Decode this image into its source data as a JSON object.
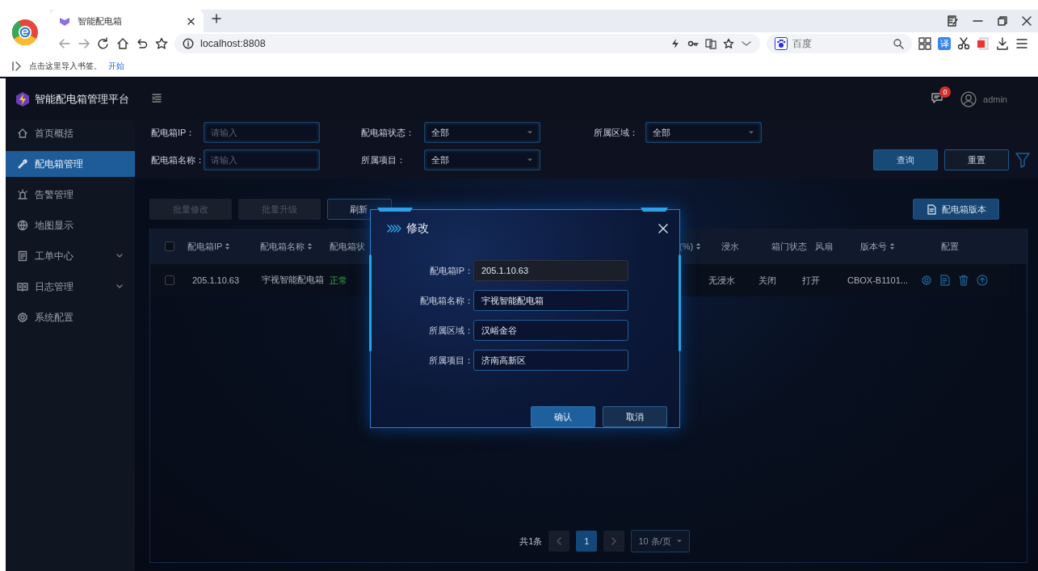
{
  "browser": {
    "tab_title": "智能配电箱",
    "address": "localhost:8808",
    "search_engine": "百度",
    "translate_badge": "译",
    "bookmark_hint": "点击这里导入书签。",
    "bookmark_link": "开始"
  },
  "app": {
    "title": "智能配电箱管理平台",
    "notification_count": "0",
    "user": "admin"
  },
  "sidebar": {
    "items": [
      {
        "label": "首页概括",
        "selected": false,
        "has_submenu": false
      },
      {
        "label": "配电箱管理",
        "selected": true,
        "has_submenu": false
      },
      {
        "label": "告警管理",
        "selected": false,
        "has_submenu": false
      },
      {
        "label": "地图显示",
        "selected": false,
        "has_submenu": false
      },
      {
        "label": "工单中心",
        "selected": false,
        "has_submenu": true
      },
      {
        "label": "日志管理",
        "selected": false,
        "has_submenu": true
      },
      {
        "label": "系统配置",
        "selected": false,
        "has_submenu": false
      }
    ]
  },
  "filters": [
    {
      "label": "配电箱IP：",
      "kind": "text",
      "placeholder": "请输入"
    },
    {
      "label": "配电箱状态：",
      "kind": "select",
      "value": "全部"
    },
    {
      "label": "所属区域：",
      "kind": "select",
      "value": "全部"
    },
    {
      "label": "配电箱名称：",
      "kind": "text",
      "placeholder": "请输入"
    },
    {
      "label": "所属项目：",
      "kind": "select",
      "value": "全部"
    }
  ],
  "filter_buttons": [
    {
      "label": "查询",
      "primary": true
    },
    {
      "label": "重置",
      "primary": false
    }
  ],
  "actions": [
    {
      "label": "批量修改",
      "disabled": true
    },
    {
      "label": "批量升级",
      "disabled": true
    },
    {
      "label": "刷新",
      "disabled": false
    }
  ],
  "version_button": "配电箱版本",
  "table": {
    "select_all_checked": false,
    "columns": [
      {
        "label": "配电箱IP",
        "sortable": true
      },
      {
        "label": "配电箱名称",
        "sortable": true
      },
      {
        "label": "配电箱状",
        "sortable": false
      },
      {
        "label": "(%)",
        "sortable": true
      },
      {
        "label": "浸水",
        "sortable": false
      },
      {
        "label": "箱门状态",
        "sortable": false
      },
      {
        "label": "风扇",
        "sortable": false
      },
      {
        "label": "版本号",
        "sortable": true
      },
      {
        "label": "配置",
        "sortable": false
      }
    ],
    "rows": [
      {
        "checked": false,
        "ip": "205.1.10.63",
        "name": "宇视智能配电箱",
        "status": "正常",
        "water": "无浸水",
        "door": "关闭",
        "fan": "打开",
        "version": "CBOX-B1101..."
      }
    ]
  },
  "pagination": {
    "total": "共1条",
    "pages": [
      {
        "label": "1",
        "selected": true
      }
    ],
    "page_size": "10 条/页"
  },
  "modal": {
    "title": "修改",
    "fields": [
      {
        "label": "配电箱IP：",
        "value": "205.1.10.63",
        "disabled": true
      },
      {
        "label": "配电箱名称：",
        "value": "宇视智能配电箱",
        "disabled": false
      },
      {
        "label": "所属区域：",
        "value": "汉峪金谷",
        "disabled": false
      },
      {
        "label": "所属项目：",
        "value": "济南高新区",
        "disabled": false
      }
    ],
    "buttons": [
      {
        "label": "确认",
        "primary": true
      },
      {
        "label": "取消",
        "primary": false
      }
    ]
  }
}
